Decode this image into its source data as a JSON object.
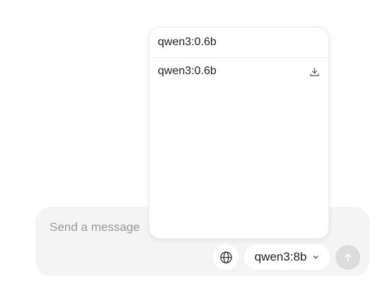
{
  "composer": {
    "placeholder": "Send a message",
    "value": "",
    "web_search_icon": "globe-icon",
    "model_selector": {
      "label": "qwen3:8b",
      "icon": "chevron-down-icon"
    },
    "send_icon": "arrow-up-icon"
  },
  "model_dropdown": {
    "search_value": "qwen3:0.6b",
    "items": [
      {
        "label": "qwen3:0.6b",
        "icon": "download-icon"
      }
    ]
  },
  "colors": {
    "composer_bg": "#f4f4f4",
    "send_disabled_bg": "#dcdcdc",
    "placeholder": "#9b9b9b",
    "text": "#1f1f1f"
  }
}
